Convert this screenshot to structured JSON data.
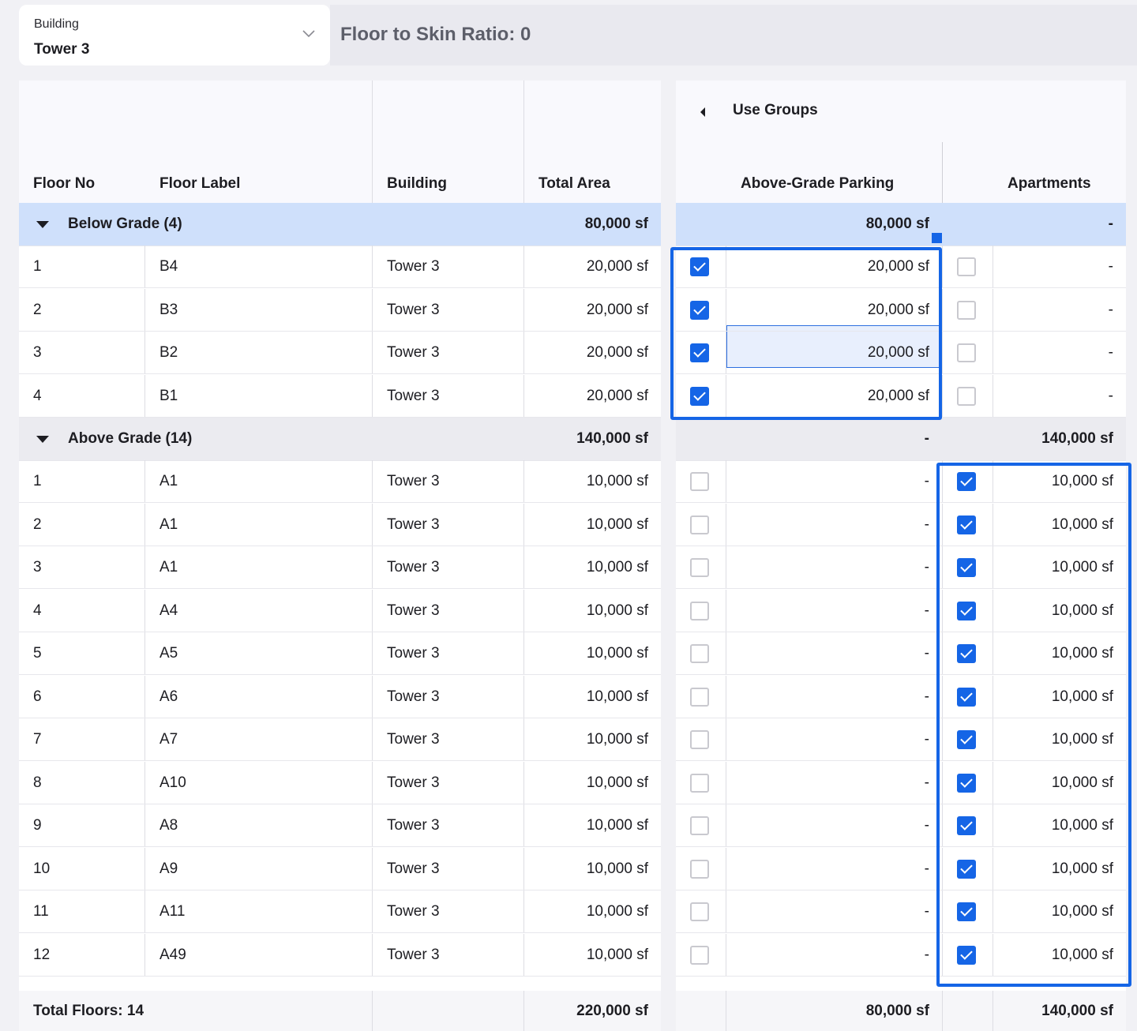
{
  "building_selector": {
    "label": "Building",
    "value": "Tower 3"
  },
  "ratio": {
    "text": "Floor to Skin Ratio: 0"
  },
  "table": {
    "headers": {
      "floor_no": "Floor No",
      "floor_label": "Floor Label",
      "building": "Building",
      "total_area": "Total Area"
    },
    "use_groups": {
      "title": "Use Groups",
      "columns": [
        "Above-Grade Parking",
        "Apartments"
      ]
    },
    "groups": [
      {
        "name": "Below Grade (4)",
        "total": "80,000 sf",
        "parking_total": "80,000 sf",
        "apartments_total": "-",
        "rows": [
          {
            "no": "1",
            "label": "B4",
            "building": "Tower 3",
            "area": "20,000 sf",
            "parking_checked": true,
            "parking": "20,000 sf",
            "apartments_checked": false,
            "apartments": "-"
          },
          {
            "no": "2",
            "label": "B3",
            "building": "Tower 3",
            "area": "20,000 sf",
            "parking_checked": true,
            "parking": "20,000 sf",
            "apartments_checked": false,
            "apartments": "-"
          },
          {
            "no": "3",
            "label": "B2",
            "building": "Tower 3",
            "area": "20,000 sf",
            "parking_checked": true,
            "parking": "20,000 sf",
            "apartments_checked": false,
            "apartments": "-"
          },
          {
            "no": "4",
            "label": "B1",
            "building": "Tower 3",
            "area": "20,000 sf",
            "parking_checked": true,
            "parking": "20,000 sf",
            "apartments_checked": false,
            "apartments": "-"
          }
        ]
      },
      {
        "name": "Above Grade (14)",
        "total": "140,000 sf",
        "parking_total": "-",
        "apartments_total": "140,000 sf",
        "rows": [
          {
            "no": "1",
            "label": "A1",
            "building": "Tower 3",
            "area": "10,000 sf",
            "parking_checked": false,
            "parking": "-",
            "apartments_checked": true,
            "apartments": "10,000 sf"
          },
          {
            "no": "2",
            "label": "A1",
            "building": "Tower 3",
            "area": "10,000 sf",
            "parking_checked": false,
            "parking": "-",
            "apartments_checked": true,
            "apartments": "10,000 sf"
          },
          {
            "no": "3",
            "label": "A1",
            "building": "Tower 3",
            "area": "10,000 sf",
            "parking_checked": false,
            "parking": "-",
            "apartments_checked": true,
            "apartments": "10,000 sf"
          },
          {
            "no": "4",
            "label": "A4",
            "building": "Tower 3",
            "area": "10,000 sf",
            "parking_checked": false,
            "parking": "-",
            "apartments_checked": true,
            "apartments": "10,000 sf"
          },
          {
            "no": "5",
            "label": "A5",
            "building": "Tower 3",
            "area": "10,000 sf",
            "parking_checked": false,
            "parking": "-",
            "apartments_checked": true,
            "apartments": "10,000 sf"
          },
          {
            "no": "6",
            "label": "A6",
            "building": "Tower 3",
            "area": "10,000 sf",
            "parking_checked": false,
            "parking": "-",
            "apartments_checked": true,
            "apartments": "10,000 sf"
          },
          {
            "no": "7",
            "label": "A7",
            "building": "Tower 3",
            "area": "10,000 sf",
            "parking_checked": false,
            "parking": "-",
            "apartments_checked": true,
            "apartments": "10,000 sf"
          },
          {
            "no": "8",
            "label": "A10",
            "building": "Tower 3",
            "area": "10,000 sf",
            "parking_checked": false,
            "parking": "-",
            "apartments_checked": true,
            "apartments": "10,000 sf"
          },
          {
            "no": "9",
            "label": "A8",
            "building": "Tower 3",
            "area": "10,000 sf",
            "parking_checked": false,
            "parking": "-",
            "apartments_checked": true,
            "apartments": "10,000 sf"
          },
          {
            "no": "10",
            "label": "A9",
            "building": "Tower 3",
            "area": "10,000 sf",
            "parking_checked": false,
            "parking": "-",
            "apartments_checked": true,
            "apartments": "10,000 sf"
          },
          {
            "no": "11",
            "label": "A11",
            "building": "Tower 3",
            "area": "10,000 sf",
            "parking_checked": false,
            "parking": "-",
            "apartments_checked": true,
            "apartments": "10,000 sf"
          },
          {
            "no": "12",
            "label": "A49",
            "building": "Tower 3",
            "area": "10,000 sf",
            "parking_checked": false,
            "parking": "-",
            "apartments_checked": true,
            "apartments": "10,000 sf"
          }
        ]
      }
    ],
    "footer": {
      "total_floors": "Total Floors: 14",
      "total_area": "220,000 sf",
      "parking_total": "80,000 sf",
      "apartments_total": "140,000 sf"
    }
  },
  "colors": {
    "accent": "#1565e6",
    "below_grade_row": "#cfe0fb",
    "above_grade_row": "#ebebf0"
  }
}
